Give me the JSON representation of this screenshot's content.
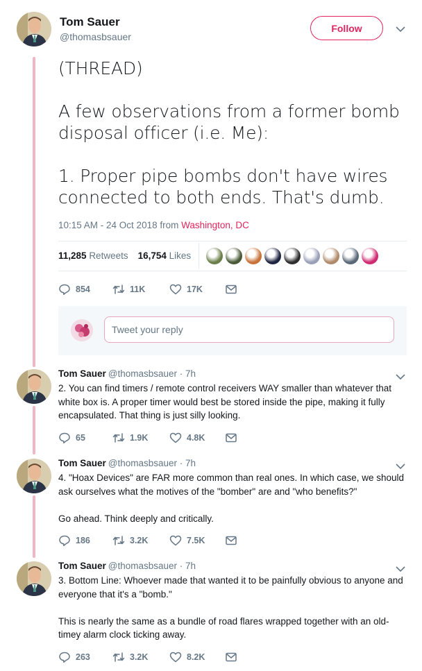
{
  "main_tweet": {
    "name": "Tom Sauer",
    "handle": "@thomasbsauer",
    "follow_label": "Follow",
    "text": "(THREAD)\n\nA few observations from a former bomb disposal officer (i.e. Me):\n\n1. Proper pipe bombs don't have wires connected to both ends.  That's dumb.",
    "timestamp": "10:15 AM - 24 Oct 2018 from ",
    "location": "Washington, DC",
    "retweets_count": "11,285",
    "retweets_label": "Retweets",
    "likes_count": "16,754",
    "likes_label": "Likes",
    "actions": {
      "replies": "854",
      "retweets": "11K",
      "likes": "17K"
    }
  },
  "reply_box": {
    "placeholder": "Tweet your reply"
  },
  "replies": [
    {
      "name": "Tom Sauer",
      "meta": "@thomasbsauer · 7h",
      "text": "2. You can find timers / remote control receivers WAY smaller than whatever that white box is.  A proper timer would best be stored inside the pipe, making it fully encapsulated.  That thing is just silly looking.",
      "actions": {
        "replies": "65",
        "retweets": "1.9K",
        "likes": "4.8K"
      }
    },
    {
      "name": "Tom Sauer",
      "meta": "@thomasbsauer · 7h",
      "text": "4. \"Hoax Devices\" are FAR more common than real ones.  In which case, we should ask ourselves what the motives of the \"bomber\" are and \"who benefits?\"\n\nGo ahead.  Think deeply and critically.",
      "actions": {
        "replies": "186",
        "retweets": "3.2K",
        "likes": "7.5K"
      }
    },
    {
      "name": "Tom Sauer",
      "meta": "@thomasbsauer · 7h",
      "text": "3. Bottom Line: Whoever made that wanted it to be painfully obvious to anyone and everyone that it's a \"bomb.\"\n\nThis is nearly the same as a bundle of road flares wrapped together with an old-timey alarm clock ticking away.",
      "actions": {
        "replies": "263",
        "retweets": "3.2K",
        "likes": "8.2K"
      }
    }
  ],
  "colors": {
    "accent": "#e0245e",
    "thread_line": "#f0b6c6",
    "muted": "#657786",
    "text": "#14171a"
  },
  "liker_colors": [
    "#6b7f4a",
    "#4a5a38",
    "#c8733a",
    "#1f2440",
    "#2e2e2e",
    "#9aa0b8",
    "#b08a6a",
    "#5a6878",
    "#d02a72"
  ]
}
